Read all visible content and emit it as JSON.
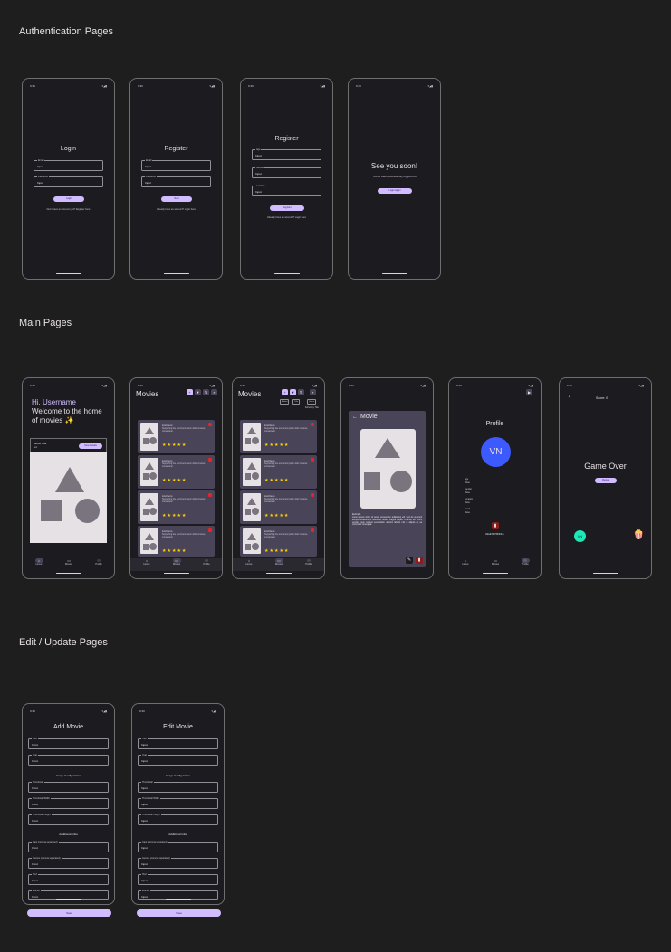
{
  "sections": {
    "auth": "Authentication Pages",
    "main": "Main Pages",
    "edit": "Edit / Update Pages"
  },
  "status": {
    "time": "9:30",
    "icons": "▾◢▮"
  },
  "login": {
    "title": "Login",
    "email_label": "Email",
    "email_value": "Input",
    "password_label": "Password",
    "password_value": "Input",
    "button": "Login",
    "footer": "Don't have an Account yet? Register here"
  },
  "register_a": {
    "title": "Register",
    "email_label": "Email",
    "email_value": "Input",
    "password_label": "Password",
    "password_value": "Input",
    "button": "Next",
    "footer": "Already have an account? Login here"
  },
  "register_b": {
    "title": "Register",
    "f1_label": "Age",
    "f1_value": "Input",
    "f2_label": "Gender",
    "f2_value": "Input",
    "f3_label": "Location",
    "f3_value": "Input",
    "button": "Register",
    "footer": "Already have an account? Login here"
  },
  "logout": {
    "title": "See you soon!",
    "message": "You've been successfully logged out",
    "button": "Login Again"
  },
  "home": {
    "greeting": "Hi, Username",
    "headline": "Welcome to the home of movies ✨",
    "card_title": "Movie Title",
    "card_sub": "text",
    "card_button": "View Details"
  },
  "nav": {
    "home": "Home",
    "movies": "Movies",
    "profile": "Profile"
  },
  "movies": {
    "title": "Movies",
    "list_header": "List Item",
    "list_desc": "Supporting line text lorem ipsum dolor sit amet, consectetur.",
    "stars": "★★★★★",
    "chips": [
      "Added",
      "Title",
      "Genre"
    ],
    "count": "Sorted by Title"
  },
  "detail": {
    "title": "Movie",
    "section": "Extract",
    "text": "Lorem ipsum dolor sit amet, consectetur adipiscing elit. Sed do eiusmod tempor incididunt ut labore et dolore magna aliqua. Ut enim ad minim veniam, quis nostrud exercitation ullamco laboris nisi ut aliquip ex ea commodo consequat."
  },
  "profile": {
    "title": "Profile",
    "initials": "VN",
    "fields": [
      "Age",
      "Gender",
      "Location",
      "Email"
    ],
    "values": [
      "Value",
      "Value",
      "Value",
      "Value"
    ],
    "delete": "DELETE PROFILE"
  },
  "game": {
    "score": "Score: 0",
    "title": "Game Over",
    "button": "Restart",
    "initials": "VN",
    "popcorn": "🍿"
  },
  "add_movie": {
    "title": "Add Movie",
    "f1_label": "Title",
    "f1_value": "Input",
    "f2_label": "Year",
    "f2_value": "Input",
    "image_section": "Image Configuration",
    "f3_label": "Thumbnail",
    "f3_value": "Input",
    "f4_label": "Thumbnail Width",
    "f4_value": "Input",
    "f5_label": "Thumbnail Height",
    "f5_value": "Input",
    "info_section": "Additional Infos",
    "f6_label": "Cast (comma separated)",
    "f6_value": "Input",
    "f7_label": "Genres (comma separated)",
    "f7_value": "Input",
    "f8_label": "Href",
    "f8_value": "Input",
    "f9_label": "Extract",
    "f9_value": "Input",
    "button": "Save"
  },
  "edit_movie": {
    "title": "Edit Movie",
    "f1_label": "Title",
    "f1_value": "Input",
    "f2_label": "Year",
    "f2_value": "Input",
    "image_section": "Image Configuration",
    "f3_label": "Thumbnail",
    "f3_value": "Input",
    "f4_label": "Thumbnail Width",
    "f4_value": "Input",
    "f5_label": "Thumbnail Height",
    "f5_value": "Input",
    "info_section": "Additional Infos",
    "f6_label": "Cast (comma separated)",
    "f6_value": "Input",
    "f7_label": "Genres (comma separated)",
    "f7_value": "Input",
    "f8_label": "Href",
    "f8_value": "Input",
    "f9_label": "Extract",
    "f9_value": "Input",
    "button": "Save"
  }
}
